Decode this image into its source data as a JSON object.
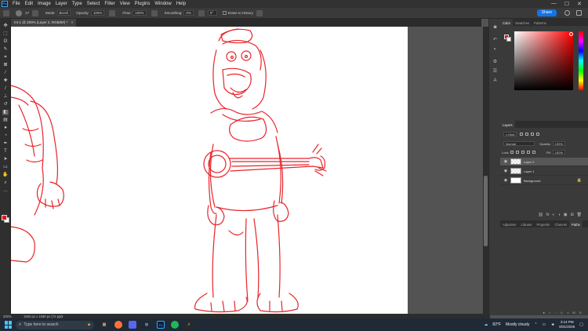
{
  "app": {
    "logo": "Ps"
  },
  "menu": [
    "File",
    "Edit",
    "Image",
    "Layer",
    "Type",
    "Select",
    "Filter",
    "View",
    "Plugins",
    "Window",
    "Help"
  ],
  "window_controls": {
    "minimize": "—",
    "maximize": "☐",
    "close": "✕"
  },
  "options_bar": {
    "brush_size": "17",
    "mode_label": "Mode:",
    "mode_value": "Brush",
    "opacity_label": "Opacity:",
    "opacity_value": "100%",
    "flow_label": "Flow:",
    "flow_value": "100%",
    "smoothing_label": "Smoothing:",
    "smoothing_value": "0%",
    "angle_value": "0°",
    "erase_history_label": "Erase to History",
    "share_label": "Share"
  },
  "document": {
    "tab_title": "mt-1 @ 200% (Layer 2, RGB/8#) *",
    "tab_close": "×"
  },
  "status": {
    "zoom": "200%",
    "doc_info": "1920 px x 1080 px (72 ppi)",
    "arrow": ">"
  },
  "tools": [
    {
      "name": "move-tool",
      "glyph": "✥"
    },
    {
      "name": "marquee-tool",
      "glyph": "⬚"
    },
    {
      "name": "lasso-tool",
      "glyph": "ʘ"
    },
    {
      "name": "quick-select-tool",
      "glyph": "✎"
    },
    {
      "name": "crop-tool",
      "glyph": "⌗"
    },
    {
      "name": "frame-tool",
      "glyph": "⊠"
    },
    {
      "name": "eyedropper-tool",
      "glyph": "⁄"
    },
    {
      "name": "healing-tool",
      "glyph": "✚"
    },
    {
      "name": "brush-tool",
      "glyph": "/"
    },
    {
      "name": "stamp-tool",
      "glyph": "⊥"
    },
    {
      "name": "history-brush-tool",
      "glyph": "↺"
    },
    {
      "name": "eraser-tool",
      "glyph": "◧"
    },
    {
      "name": "gradient-tool",
      "glyph": "▤"
    },
    {
      "name": "blur-tool",
      "glyph": "●"
    },
    {
      "name": "dodge-tool",
      "glyph": "◔"
    },
    {
      "name": "pen-tool",
      "glyph": "✒"
    },
    {
      "name": "type-tool",
      "glyph": "T"
    },
    {
      "name": "path-select-tool",
      "glyph": "➤"
    },
    {
      "name": "shape-tool",
      "glyph": "▭"
    },
    {
      "name": "hand-tool",
      "glyph": "✋"
    },
    {
      "name": "zoom-tool",
      "glyph": "⌕"
    },
    {
      "name": "more-tools",
      "glyph": "…"
    }
  ],
  "panels": {
    "color_tabs": [
      "Color",
      "Swatches",
      "Patterns"
    ],
    "layers_tabs": [
      "Layers"
    ],
    "kind_label": "Kind",
    "blend_mode": "Normal",
    "opacity_label": "Opacity:",
    "opacity_value": "100%",
    "lock_label": "Lock:",
    "fill_label": "Fill:",
    "fill_value": "100%",
    "layers": [
      {
        "name": "Layer 2",
        "selected": true,
        "thumb": "checker"
      },
      {
        "name": "Layer 1",
        "selected": false,
        "thumb": "checker"
      },
      {
        "name": "Background",
        "selected": false,
        "thumb": "white"
      }
    ],
    "layer_bottom_icons": [
      "⛓",
      "fx",
      "◐",
      "◑",
      "▣",
      "⊞",
      "🗑"
    ],
    "bottom_tabs": [
      "Adjustme",
      "Librarie",
      "Propertie",
      "Channel",
      "Paths"
    ],
    "bottom_tab_active": "Paths"
  },
  "colors": {
    "fg": "#e6151a",
    "bg": "#ffffff",
    "accent": "#1473e6",
    "sketch": "#e8242a"
  },
  "taskbar": {
    "search_placeholder": "Type here to search",
    "weather_temp": "82°F",
    "weather_desc": "Mostly cloudy",
    "time": "3:14 PM",
    "date": "8/31/2025"
  }
}
